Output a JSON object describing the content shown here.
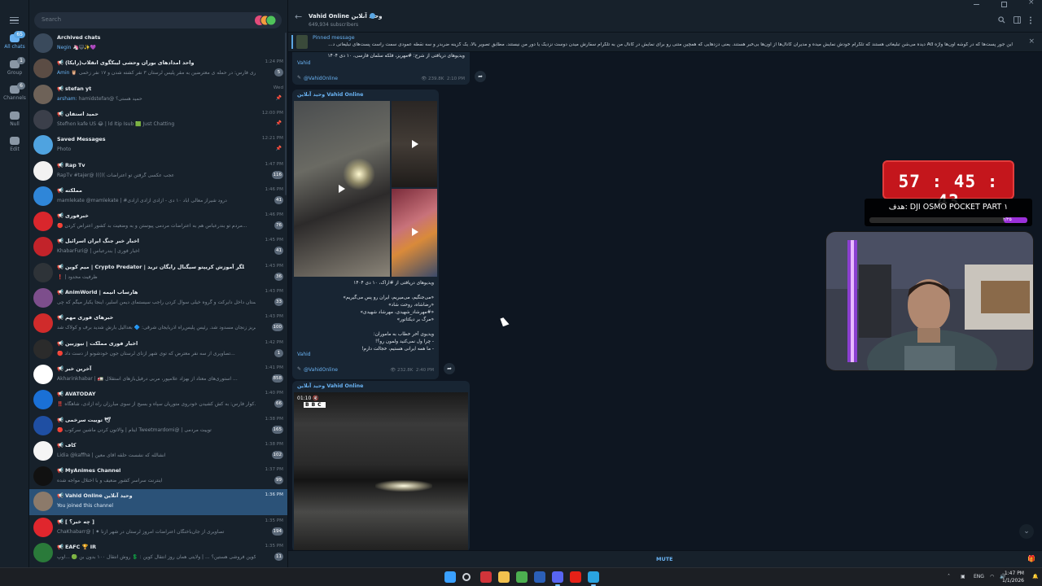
{
  "rail": {
    "items": [
      {
        "label": "All chats",
        "badge": "65",
        "icon": "chat-bubble-icon"
      },
      {
        "label": "Group",
        "badge": "1",
        "icon": "group-icon"
      },
      {
        "label": "Channels",
        "badge": "6",
        "icon": "megaphone-icon"
      },
      {
        "label": "Null",
        "badge": "",
        "icon": "mask-icon"
      },
      {
        "label": "Edit",
        "badge": "",
        "icon": "sliders-icon"
      }
    ]
  },
  "search": {
    "placeholder": "Search"
  },
  "chats": [
    {
      "title": "Archived chats",
      "channel": false,
      "verified": false,
      "sender": "Negin",
      "preview": "🦄😺✨💜",
      "time": "",
      "badge": "",
      "pinned": false,
      "avatar_color": "#3a4a5c",
      "avatar_icon": "archive-icon"
    },
    {
      "title": "واحد امدادهای بوران وحشی لیبکگوی انقلاب(رایکا)",
      "channel": true,
      "verified": false,
      "sender": "Amin",
      "preview": "🦉 فوری فارس: در حمله ی معترضین به مقر پلیس لرستان ۳ نفر کشته شدن و ۱۷ نفر زخمی...",
      "time": "1:24 PM",
      "badge": "5",
      "pinned": false,
      "avatar_color": "#5b4c44",
      "avatar_icon": ""
    },
    {
      "title": "stefan yt",
      "channel": true,
      "verified": false,
      "sender": "arsham:",
      "preview": "hamidstefan@ حمید هستی؟",
      "time": "Wed",
      "badge": "",
      "pinned": true,
      "avatar_color": "#6e6258",
      "avatar_icon": ""
    },
    {
      "title": "حمید استفان",
      "channel": true,
      "verified": false,
      "sender": "",
      "preview": "Stefhon kafe US 😂 | ld Itip Isub 🟩 Just Chatting",
      "time": "12:00 PM",
      "badge": "",
      "pinned": true,
      "avatar_color": "#3b3f4a",
      "avatar_icon": ""
    },
    {
      "title": "Saved Messages",
      "channel": false,
      "verified": false,
      "sender": "",
      "preview": "Photo",
      "time": "12:21 PM",
      "badge": "",
      "pinned": true,
      "avatar_color": "#4fa3e0",
      "avatar_icon": "bookmark-icon"
    },
    {
      "title": "Rap Tv",
      "channel": true,
      "verified": false,
      "sender": "",
      "preview": "RapTv #tajer@ ((((( عجب عکسی گرفتن تو اعتراضات",
      "time": "1:47 PM",
      "badge": "116",
      "pinned": false,
      "avatar_color": "#f2f2f2",
      "avatar_icon": ""
    },
    {
      "title": "مملکته",
      "channel": true,
      "verified": true,
      "sender": "",
      "preview": "mamlekate @mamlekate | #درود شیراز معالی اباد ۱۰ دی - آزادی آزادی آزادی",
      "time": "1:46 PM",
      "badge": "41",
      "pinned": false,
      "avatar_color": "#2f86d8",
      "avatar_icon": ""
    },
    {
      "title": "خبرفوری",
      "channel": true,
      "verified": false,
      "sender": "",
      "preview": "🔴 مردم تو بندرعباس هم به اعتراضات مردمی پیوستن و به وضعیت بد کشور اعتراض کردن...",
      "time": "1:46 PM",
      "badge": "76",
      "pinned": false,
      "avatar_color": "#d9262c",
      "avatar_icon": ""
    },
    {
      "title": "اخبار خبر جنگ ایران اسرائیل",
      "channel": true,
      "verified": false,
      "sender": "",
      "preview": "KhabarFuri@ | اخبار فوری | بندرعباس",
      "time": "1:45 PM",
      "badge": "41",
      "pinned": false,
      "avatar_color": "#c2232a",
      "avatar_icon": ""
    },
    {
      "title": "میم کوین | Crypto Predator | تحلیلگر آموزش کریپتو سیگنال رایگان ترید",
      "channel": true,
      "verified": false,
      "sender": "",
      "preview": "❗ | ظرفیت محدود",
      "time": "1:43 PM",
      "badge": "36",
      "pinned": false,
      "avatar_color": "#2e3338",
      "avatar_icon": ""
    },
    {
      "title": "AnimWorld | هارساب انیمه",
      "channel": true,
      "verified": false,
      "sender": "",
      "preview": "سلام دوستان داخل دایرکت و گروه خیلی سوال کردن راجب سیستمای دیمن اسلیر، اینجا یکبار میگم که چی...",
      "time": "1:43 PM",
      "badge": "33",
      "pinned": false,
      "avatar_color": "#7d4e8c",
      "avatar_icon": ""
    },
    {
      "title": "خبرهای فوری مهم",
      "channel": true,
      "verified": false,
      "sender": "",
      "preview": "اتوبان تبریز زنجان مسدود شد. رئیس پلیس‌راه آذربایجان شرقی: 🔷 بعدالیل بارش شدید برف و کولاک شد...",
      "time": "1:43 PM",
      "badge": "100",
      "pinned": false,
      "avatar_color": "#d02b2b",
      "avatar_icon": ""
    },
    {
      "title": "اخبار فوری مملکت | نیوزبین",
      "channel": true,
      "verified": false,
      "sender": "",
      "preview": "🔴 تصاویری از سه نفر معترض که توی شهر ازنای لرستان جون خودشونو از دست داد...",
      "time": "1:42 PM",
      "badge": "1",
      "pinned": false,
      "avatar_color": "#2b2b2b",
      "avatar_icon": ""
    },
    {
      "title": "آخرین خبر",
      "channel": true,
      "verified": false,
      "sender": "",
      "preview": "Akharinkhabar | 🚛 استوری‌های معتاد از بهزاد علامپور، مربی درفیل‌بازهای استقلال ...",
      "time": "1:41 PM",
      "badge": "858",
      "pinned": false,
      "avatar_color": "#ffffff",
      "avatar_icon": ""
    },
    {
      "title": "AVATODAY",
      "channel": true,
      "verified": false,
      "sender": "",
      "preview": "‼️ کوار فارس: به کش کشیدن خودروی متوریان سپاه و بسیج از سوی مبارزان راه آزادی، شاهگاه...",
      "time": "1:40 PM",
      "badge": "66",
      "pinned": false,
      "avatar_color": "#1a70d6",
      "avatar_icon": ""
    },
    {
      "title": "توییت سرخمی 🕊",
      "channel": true,
      "verified": false,
      "sender": "",
      "preview": "🔴 ایتام | والاتون کردن ماشین سرکوب Tweetmardomi@ | توییت مردمی",
      "time": "1:38 PM",
      "badge": "165",
      "pinned": false,
      "avatar_color": "#1f4fa3",
      "avatar_icon": ""
    },
    {
      "title": "کاف",
      "channel": true,
      "verified": false,
      "sender": "",
      "preview": "Lidia @kaffha | انشالله که نشست حلقه آقای معین",
      "time": "1:38 PM",
      "badge": "102",
      "pinned": false,
      "avatar_color": "#f5f5f5",
      "avatar_icon": ""
    },
    {
      "title": "MyAnimes Channel",
      "channel": true,
      "verified": false,
      "sender": "",
      "preview": "اینترنت سراسر کشور ضعیف و با اختلال مواجه شده",
      "time": "1:37 PM",
      "badge": "99",
      "pinned": false,
      "avatar_color": "#111111",
      "avatar_icon": ""
    },
    {
      "title": "Vahid Online وحید آنلاین",
      "channel": true,
      "verified": true,
      "sender": "",
      "preview": "You joined this channel",
      "time": "1:36 PM",
      "badge": "",
      "pinned": false,
      "avatar_color": "#8c7a6a",
      "avatar_icon": ""
    },
    {
      "title": "[ چه خبر؟ ]",
      "channel": true,
      "verified": false,
      "sender": "",
      "preview": "ChaKhabarr@ | ⚫ تصاویری از جان‌باختگان اعتراضات امروز لرستان در شهر ازنا",
      "time": "1:35 PM",
      "badge": "194",
      "pinned": false,
      "avatar_color": "#e0262d",
      "avatar_icon": ""
    },
    {
      "title": "EAFC 🏆 IR",
      "channel": true,
      "verified": false,
      "sender": "",
      "preview": "آماده کوین فروشی هستین؟ ... | ولایتی همان روز انتقال کوین : 💲 روش انتقال ۱۰۰ بدون بن 🟢 ...اوپ",
      "time": "1:35 PM",
      "badge": "11",
      "pinned": false,
      "avatar_color": "#2a7a3a",
      "avatar_icon": ""
    }
  ],
  "header": {
    "channel_name": "Vahid Online وحید آنلاین",
    "subscribers": "649,934 subscribers"
  },
  "pinned": {
    "label": "Pinned message",
    "text": "این جور پست‌ها که در گوشه اون‌ها واژه Ad دیده می‌شن تبلیغاتی هستند که تلگرام خودش نمایش میده و مدیران کانال‌ها از اون‌ها بی‌خبر هستند. یعنی دزدهایی که همچین متنی رو برای نمایش در کانال من به تلگرام سفارش میدن دوست نزدیک یا دور من نیستند. مطابق تصویر بالا، یک گزینه ضربدر و سه نقطه عمودی سمت راست پست‌های تبلیغاتی د..."
  },
  "messages": [
    {
      "author": "",
      "text": "ویدیوهای دریافتی از شرح: #مهریز، فلکه سلمان فارسی، ۱۰ دی ۱۴۰۴",
      "sign": "Vahid",
      "link": "@VahidOnline",
      "views": "239.8K",
      "time": "2:10 PM"
    },
    {
      "author": "وحید آنلاین Vahid Online",
      "text": "ویدیوهای دریافتی از #اراک، ۱۰ دی ۱۴۰۴\n\n«می‌جنگیم، می‌میریم، ایران رو پس می‌گیریم»\n«رضاشاه، روحت شاد»\n«#مهرشاد_شهیدی، مهرشاد شهیدی»\n«مرگ بر دیکتاتور»\n\nویدیوی آخر خطاب به ماموران:\n- چرا ول نمی‌کنید ولمون رو؟!\n- ما همه ایرانی هستیم، خجالت دارم!",
      "sign": "Vahid",
      "link": "@VahidOnline",
      "views": "232.8K",
      "time": "2:40 PM"
    },
    {
      "author": "وحید آنلاین Vahid Online",
      "video_time": "01:10 🔇",
      "bbc": "BBC"
    }
  ],
  "bottom": {
    "mute_label": "MUTE"
  },
  "overlay": {
    "timer": "57 : 45 : 43",
    "goal_text": "هدف: DJI OSMO POCKET PART ۱",
    "goal_count": "۲/۲۵",
    "goal_fraction": 0.15
  },
  "taskbar": {
    "lang": "ENG",
    "time": "1:47 PM",
    "date": "1/1/2026",
    "apps": [
      {
        "name": "windows-start-icon",
        "color": "#3aa0ff"
      },
      {
        "name": "search-icon",
        "color": "#cfd4da"
      },
      {
        "name": "app-red-icon",
        "color": "#d1343a"
      },
      {
        "name": "file-explorer-icon",
        "color": "#f2c14e"
      },
      {
        "name": "chrome-icon",
        "color": "#4caf50"
      },
      {
        "name": "word-icon",
        "color": "#2b5fb8"
      },
      {
        "name": "discord-icon",
        "color": "#5865f2"
      },
      {
        "name": "youtube-icon",
        "color": "#e62117"
      },
      {
        "name": "telegram-icon",
        "color": "#2aa3df"
      }
    ]
  }
}
